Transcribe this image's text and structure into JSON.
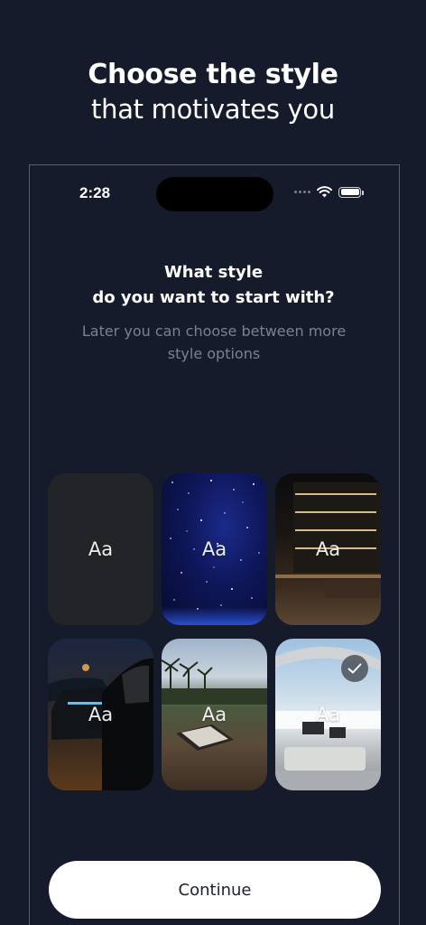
{
  "header": {
    "title_line1": "Choose the style",
    "title_line2": "that motivates you"
  },
  "status_bar": {
    "time": "2:28"
  },
  "question": {
    "line1": "What style",
    "line2": "do you want to start with?"
  },
  "subtitle": {
    "line1": "Later you can choose between more",
    "line2": "style options"
  },
  "styles": [
    {
      "label": "Aa",
      "theme": "dark",
      "selected": false
    },
    {
      "label": "Aa",
      "theme": "starry-night",
      "selected": false
    },
    {
      "label": "Aa",
      "theme": "hotel-night",
      "selected": false
    },
    {
      "label": "Aa",
      "theme": "car-night",
      "selected": false
    },
    {
      "label": "Aa",
      "theme": "terrace",
      "selected": false
    },
    {
      "label": "Aa",
      "theme": "boat",
      "selected": true
    }
  ],
  "continue_label": "Continue",
  "colors": {
    "background": "#151b2b",
    "button": "#ffffff",
    "subtitle_text": "#7b8190"
  }
}
